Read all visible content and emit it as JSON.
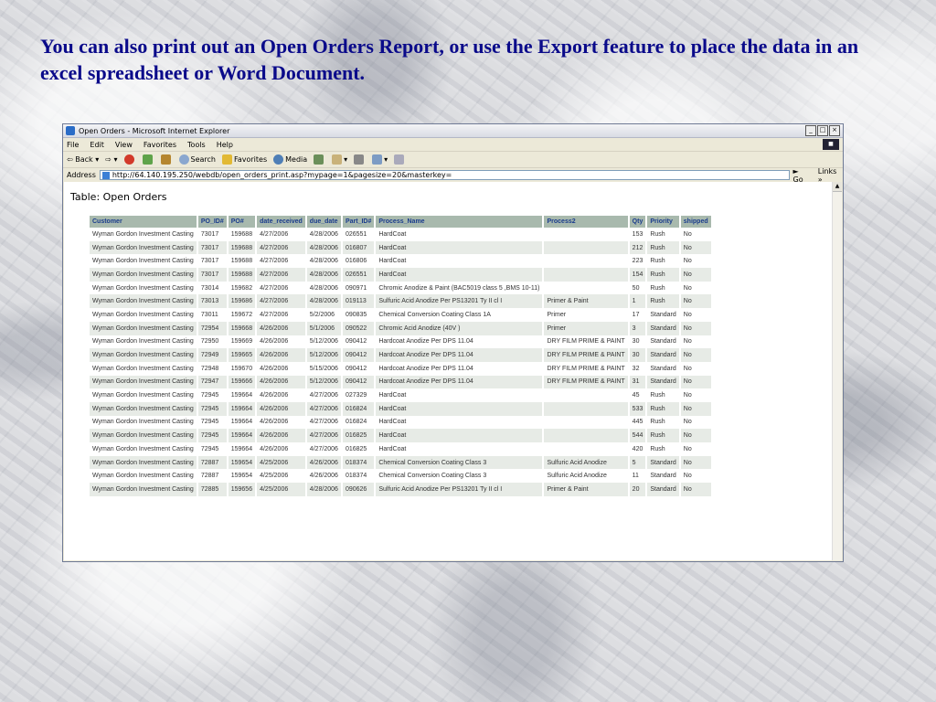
{
  "caption": "You can also print out an Open Orders Report, or use the Export feature to place the data in an excel spreadsheet or Word Document.",
  "window": {
    "title": "Open Orders - Microsoft Internet Explorer",
    "controls": [
      "_",
      "□",
      "×"
    ]
  },
  "menu": [
    "File",
    "Edit",
    "View",
    "Favorites",
    "Tools",
    "Help"
  ],
  "toolbar": {
    "back": "Back",
    "search": "Search",
    "favorites": "Favorites",
    "media": "Media"
  },
  "address": {
    "label": "Address",
    "url": "http://64.140.195.250/webdb/open_orders_print.asp?mypage=1&pagesize=20&masterkey=",
    "go": "Go",
    "links": "Links"
  },
  "page": {
    "heading": "Table: Open Orders"
  },
  "table": {
    "columns": [
      "Customer",
      "PO_ID#",
      "PO#",
      "date_received",
      "due_date",
      "Part_ID#",
      "Process_Name",
      "Process2",
      "Qty",
      "Priority",
      "shipped"
    ],
    "rows": [
      [
        "Wyman Gordon Investment Casting",
        "73017",
        "159688",
        "4/27/2006",
        "4/28/2006",
        "026551",
        "HardCoat",
        "",
        "153",
        "Rush",
        "No"
      ],
      [
        "Wyman Gordon Investment Casting",
        "73017",
        "159688",
        "4/27/2006",
        "4/28/2006",
        "016807",
        "HardCoat",
        "",
        "212",
        "Rush",
        "No"
      ],
      [
        "Wyman Gordon Investment Casting",
        "73017",
        "159688",
        "4/27/2006",
        "4/28/2006",
        "016806",
        "HardCoat",
        "",
        "223",
        "Rush",
        "No"
      ],
      [
        "Wyman Gordon Investment Casting",
        "73017",
        "159688",
        "4/27/2006",
        "4/28/2006",
        "026551",
        "HardCoat",
        "",
        "154",
        "Rush",
        "No"
      ],
      [
        "Wyman Gordon Investment Casting",
        "73014",
        "159682",
        "4/27/2006",
        "4/28/2006",
        "090971",
        "Chromic Anodize & Paint (BAC5019 class 5 ,BMS 10-11)",
        "",
        "50",
        "Rush",
        "No"
      ],
      [
        "Wyman Gordon Investment Casting",
        "73013",
        "159686",
        "4/27/2006",
        "4/28/2006",
        "019113",
        "Sulfuric Acid Anodize Per PS13201 Ty II cl I",
        "Primer & Paint",
        "1",
        "Rush",
        "No"
      ],
      [
        "Wyman Gordon Investment Casting",
        "73011",
        "159672",
        "4/27/2006",
        "5/2/2006",
        "090835",
        "Chemical Conversion Coating Class 1A",
        "Primer",
        "17",
        "Standard",
        "No"
      ],
      [
        "Wyman Gordon Investment Casting",
        "72954",
        "159668",
        "4/26/2006",
        "5/1/2006",
        "090522",
        "Chromic Acid Anodize (40V )",
        "Primer",
        "3",
        "Standard",
        "No"
      ],
      [
        "Wyman Gordon Investment Casting",
        "72950",
        "159669",
        "4/26/2006",
        "5/12/2006",
        "090412",
        "Hardcoat Anodize Per DPS 11.04",
        "DRY FILM PRIME & PAINT",
        "30",
        "Standard",
        "No"
      ],
      [
        "Wyman Gordon Investment Casting",
        "72949",
        "159665",
        "4/26/2006",
        "5/12/2006",
        "090412",
        "Hardcoat Anodize Per DPS 11.04",
        "DRY FILM PRIME & PAINT",
        "30",
        "Standard",
        "No"
      ],
      [
        "Wyman Gordon Investment Casting",
        "72948",
        "159670",
        "4/26/2006",
        "5/15/2006",
        "090412",
        "Hardcoat Anodize Per DPS 11.04",
        "DRY FILM PRIME & PAINT",
        "32",
        "Standard",
        "No"
      ],
      [
        "Wyman Gordon Investment Casting",
        "72947",
        "159666",
        "4/26/2006",
        "5/12/2006",
        "090412",
        "Hardcoat Anodize Per DPS 11.04",
        "DRY FILM PRIME & PAINT",
        "31",
        "Standard",
        "No"
      ],
      [
        "Wyman Gordon Investment Casting",
        "72945",
        "159664",
        "4/26/2006",
        "4/27/2006",
        "027329",
        "HardCoat",
        "",
        "45",
        "Rush",
        "No"
      ],
      [
        "Wyman Gordon Investment Casting",
        "72945",
        "159664",
        "4/26/2006",
        "4/27/2006",
        "016824",
        "HardCoat",
        "",
        "533",
        "Rush",
        "No"
      ],
      [
        "Wyman Gordon Investment Casting",
        "72945",
        "159664",
        "4/26/2006",
        "4/27/2006",
        "016824",
        "HardCoat",
        "",
        "445",
        "Rush",
        "No"
      ],
      [
        "Wyman Gordon Investment Casting",
        "72945",
        "159664",
        "4/26/2006",
        "4/27/2006",
        "016825",
        "HardCoat",
        "",
        "544",
        "Rush",
        "No"
      ],
      [
        "Wyman Gordon Investment Casting",
        "72945",
        "159664",
        "4/26/2006",
        "4/27/2006",
        "016825",
        "HardCoat",
        "",
        "420",
        "Rush",
        "No"
      ],
      [
        "Wyman Gordon Investment Casting",
        "72887",
        "159654",
        "4/25/2006",
        "4/26/2006",
        "018374",
        "Chemical Conversion Coating Class 3",
        "Sulfuric Acid Anodize",
        "5",
        "Standard",
        "No"
      ],
      [
        "Wyman Gordon Investment Casting",
        "72887",
        "159654",
        "4/25/2006",
        "4/26/2006",
        "018374",
        "Chemical Conversion Coating Class 3",
        "Sulfuric Acid Anodize",
        "11",
        "Standard",
        "No"
      ],
      [
        "Wyman Gordon Investment Casting",
        "72885",
        "159656",
        "4/25/2006",
        "4/28/2006",
        "090626",
        "Sulfuric Acid Anodize Per PS13201 Ty II cl I",
        "Primer & Paint",
        "20",
        "Standard",
        "No"
      ]
    ]
  },
  "colors": {
    "caption": "#0a0a8a",
    "header_bg": "#a8b9ad",
    "header_text": "#1a3c8c",
    "alt_row": "#e7ebe6"
  }
}
